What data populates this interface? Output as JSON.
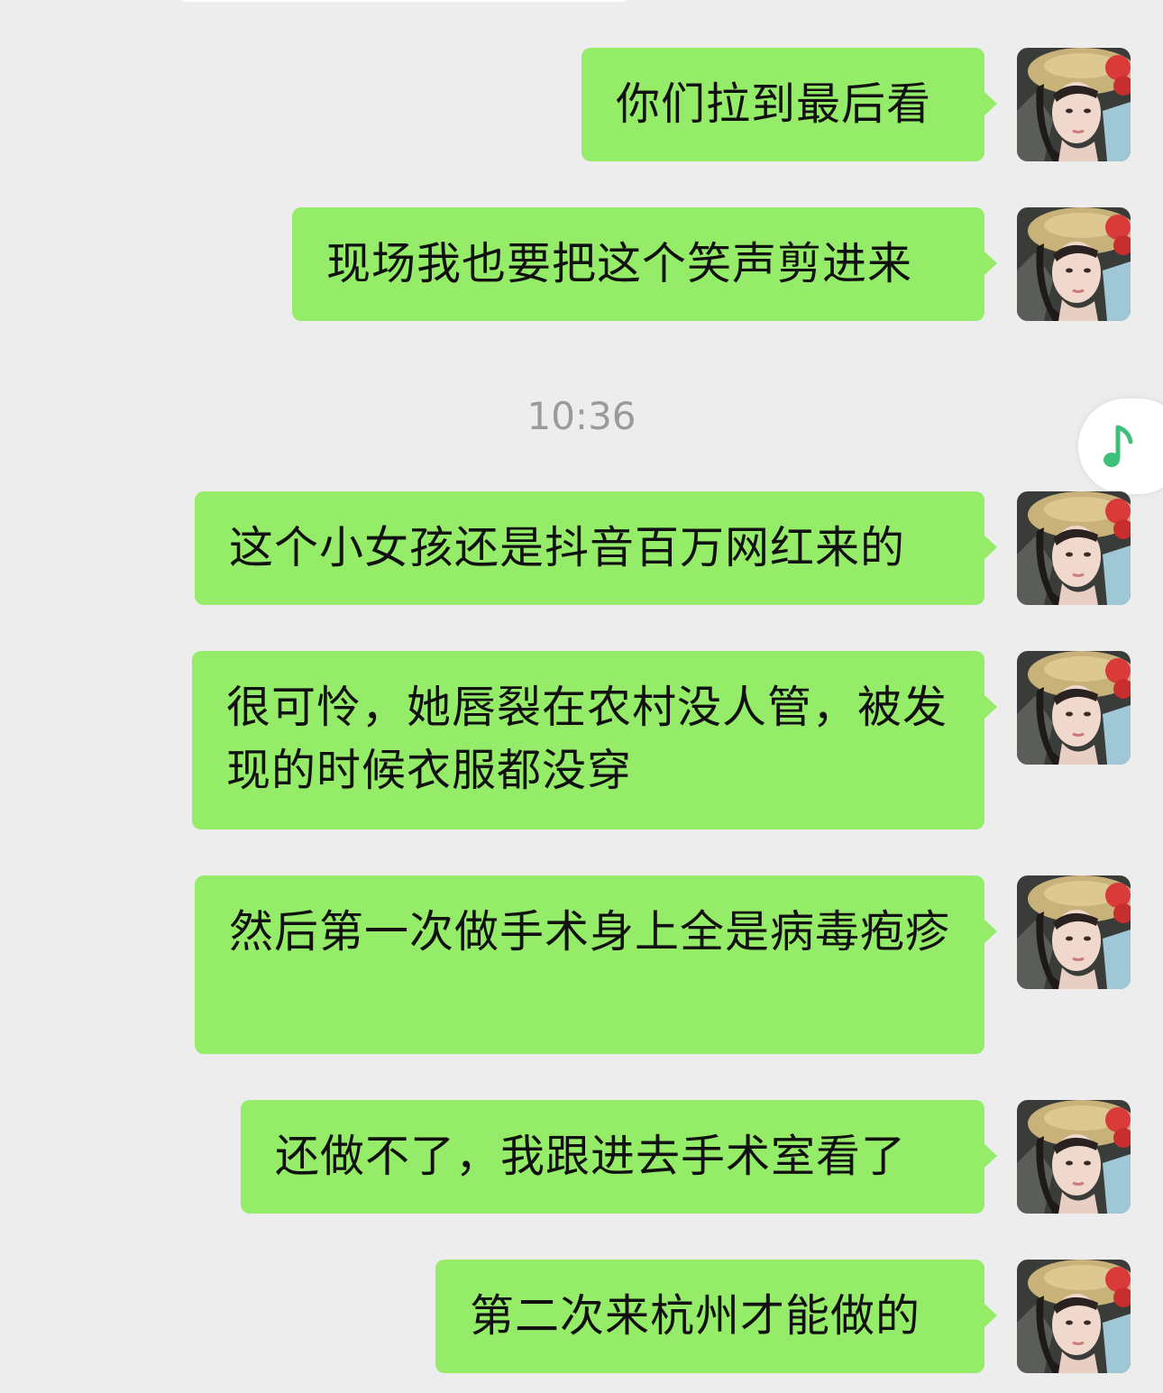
{
  "chat": {
    "timestamp": "10:36",
    "messages": [
      {
        "text": "你们拉到最后看",
        "avatar_icon": "user-avatar-straw-hat"
      },
      {
        "text": "现场我也要把这个笑声剪进来",
        "avatar_icon": "user-avatar-straw-hat"
      },
      {
        "text": "这个小女孩还是抖音百万网红来的",
        "avatar_icon": "user-avatar-straw-hat"
      },
      {
        "text": "很可怜，她唇裂在农村没人管，被发现的时候衣服都没穿",
        "avatar_icon": "user-avatar-straw-hat"
      },
      {
        "text": "然后第一次做手术身上全是病毒疱疹",
        "avatar_icon": "user-avatar-straw-hat"
      },
      {
        "text": "还做不了，我跟进去手术室看了",
        "avatar_icon": "user-avatar-straw-hat"
      },
      {
        "text": "第二次来杭州才能做的",
        "avatar_icon": "user-avatar-straw-hat"
      }
    ]
  },
  "floating_button": {
    "icon": "music-note-icon"
  },
  "colors": {
    "background": "#ededed",
    "bubble": "#95ec69",
    "timestamp": "#9a9a9a",
    "music_icon": "#3ec07a"
  }
}
